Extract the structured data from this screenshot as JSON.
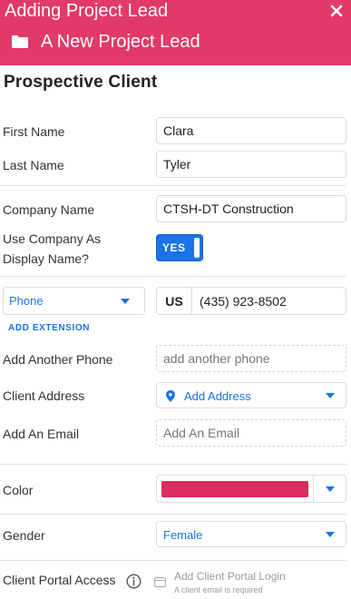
{
  "header": {
    "title": "Adding Project Lead",
    "subtitle": "A New Project Lead",
    "accent_color": "#e23a68",
    "close_icon": "close-icon",
    "folder_icon": "folder-icon"
  },
  "section_title": "Prospective Client",
  "fields": {
    "first_name": {
      "label": "First Name",
      "value": "Clara"
    },
    "last_name": {
      "label": "Last Name",
      "value": "Tyler"
    },
    "company_name": {
      "label": "Company Name",
      "value": "CTSH-DT Construction"
    },
    "use_company_display": {
      "label": "Use Company As Display Name?",
      "toggle": "YES",
      "on": true
    },
    "phone": {
      "type": "Phone",
      "country": "US",
      "number": "(435) 923-8502",
      "add_extension": "ADD EXTENSION"
    },
    "another_phone": {
      "label": "Add Another Phone",
      "placeholder": "add another phone"
    },
    "address": {
      "label": "Client Address",
      "value": "Add Address"
    },
    "email": {
      "label": "Add An Email",
      "placeholder": "Add An Email"
    },
    "color": {
      "label": "Color",
      "value": "#dc2e5e"
    },
    "gender": {
      "label": "Gender",
      "value": "Female"
    },
    "portal": {
      "label": "Client Portal Access",
      "link": "Add Client Portal Login",
      "note": "A client email is required"
    }
  },
  "colors": {
    "link_blue": "#1a73e8",
    "muted": "#9a9a9a"
  }
}
